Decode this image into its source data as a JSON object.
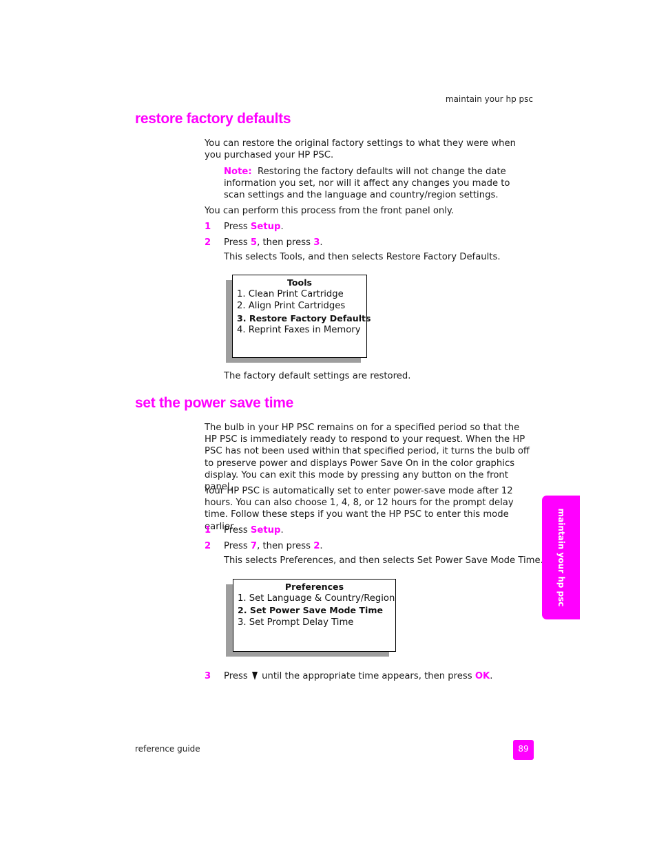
{
  "header": {
    "running_head": "maintain your hp psc"
  },
  "section1": {
    "title": "restore factory defaults",
    "intro": "You can restore the original factory settings to what they were when you purchased your HP PSC.",
    "note_label": "Note:",
    "note_text": "Restoring the factory defaults will not change the date information you set, nor will it affect any changes you made to scan settings and the language and country/region settings.",
    "front_panel": "You can perform this process from the front panel only.",
    "steps": [
      {
        "num": "1",
        "pre": "Press ",
        "key1": "Setup",
        "mid": "",
        "key2": "",
        "post": "."
      },
      {
        "num": "2",
        "pre": "Press ",
        "key1": "5",
        "mid": ", then press ",
        "key2": "3",
        "post": "."
      }
    ],
    "step2_detail": "This selects Tools, and then selects Restore Factory Defaults.",
    "menu": {
      "title": "Tools",
      "items": [
        {
          "label": "1. Clean Print Cartridge",
          "selected": false
        },
        {
          "label": "2. Align Print Cartridges",
          "selected": false
        },
        {
          "label": "3. Restore Factory Defaults",
          "selected": true
        },
        {
          "label": "4. Reprint Faxes in Memory",
          "selected": false
        }
      ]
    },
    "result": "The factory default settings are restored."
  },
  "section2": {
    "title": "set the power save time",
    "para1": "The bulb in your HP PSC remains on for a specified period so that the HP PSC is immediately ready to respond to your request. When the HP PSC has not been used within that specified period, it turns the bulb off to preserve power and displays Power Save On in the color graphics display. You can exit this mode by pressing any button on the front panel.",
    "para2": "Your HP PSC is automatically set to enter power-save mode after 12 hours. You can also choose 1, 4, 8, or 12 hours for the prompt delay time. Follow these steps if you want the HP PSC to enter this mode earlier.",
    "steps": [
      {
        "num": "1",
        "pre": "Press ",
        "key1": "Setup",
        "mid": "",
        "key2": "",
        "post": "."
      },
      {
        "num": "2",
        "pre": "Press ",
        "key1": "7",
        "mid": ", then press ",
        "key2": "2",
        "post": "."
      }
    ],
    "step2_detail": "This selects Preferences, and then selects Set Power Save Mode Time.",
    "menu": {
      "title": "Preferences",
      "items": [
        {
          "label": "1. Set Language & Country/Region",
          "selected": false
        },
        {
          "label": "2. Set Power Save Mode Time",
          "selected": true
        },
        {
          "label": "3. Set Prompt Delay Time",
          "selected": false
        }
      ]
    },
    "step3": {
      "num": "3",
      "pre": "Press",
      "icon": "down-arrow-icon",
      "mid": "until the appropriate time appears, then press ",
      "key": "OK",
      "post": "."
    }
  },
  "side_tab": {
    "label": "maintain your hp psc"
  },
  "footer": {
    "left": "reference guide",
    "page_number": "89"
  },
  "colors": {
    "accent": "#ff00ff",
    "shadow": "#9e9e9e"
  }
}
